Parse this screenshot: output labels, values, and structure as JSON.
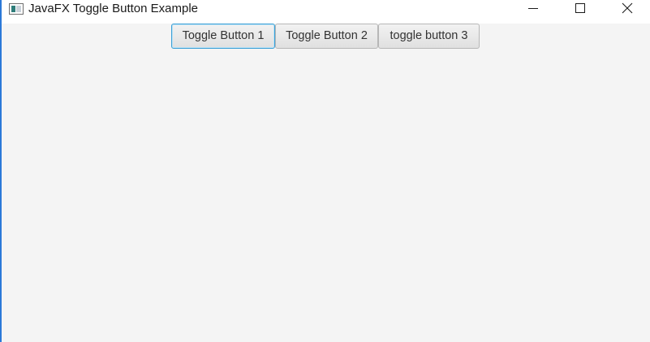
{
  "window": {
    "title": "JavaFX Toggle Button Example",
    "icons": {
      "app": "application-window-icon",
      "minimize": "minimize-icon",
      "maximize": "maximize-icon",
      "close": "close-icon"
    }
  },
  "toggle_buttons": [
    {
      "label": "Toggle Button 1",
      "focused": true
    },
    {
      "label": "Toggle Button 2",
      "focused": false
    },
    {
      "label": "toggle button 3",
      "focused": false
    }
  ],
  "colors": {
    "focus_border": "#3a9fd6",
    "window_accent": "#2b79d8",
    "content_background": "#f4f4f4"
  }
}
